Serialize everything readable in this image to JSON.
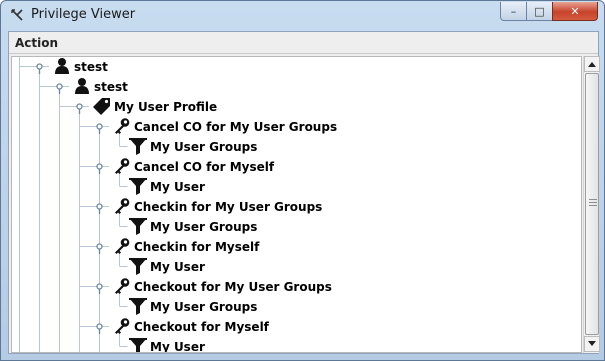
{
  "window": {
    "title": "Privilege Viewer",
    "buttons": {
      "minimize": "–",
      "maximize": "□",
      "close": "✕"
    }
  },
  "menu": {
    "action": "Action"
  },
  "tree": {
    "nodes": [
      {
        "label": "stest",
        "icon": "user-icon",
        "depth": 0
      },
      {
        "label": "stest",
        "icon": "user-icon",
        "depth": 1
      },
      {
        "label": "My User Profile",
        "icon": "tag-icon",
        "depth": 2
      },
      {
        "label": "Cancel CO for My User Groups",
        "icon": "key-icon",
        "depth": 3
      },
      {
        "label": "My User Groups",
        "icon": "filter-icon",
        "depth": 4
      },
      {
        "label": "Cancel CO for Myself",
        "icon": "key-icon",
        "depth": 3
      },
      {
        "label": "My User",
        "icon": "filter-icon",
        "depth": 4
      },
      {
        "label": "Checkin for My User Groups",
        "icon": "key-icon",
        "depth": 3
      },
      {
        "label": "My User Groups",
        "icon": "filter-icon",
        "depth": 4
      },
      {
        "label": "Checkin for Myself",
        "icon": "key-icon",
        "depth": 3
      },
      {
        "label": "My User",
        "icon": "filter-icon",
        "depth": 4
      },
      {
        "label": "Checkout for My User Groups",
        "icon": "key-icon",
        "depth": 3
      },
      {
        "label": "My User Groups",
        "icon": "filter-icon",
        "depth": 4
      },
      {
        "label": "Checkout for Myself",
        "icon": "key-icon",
        "depth": 3
      },
      {
        "label": "My User",
        "icon": "filter-icon",
        "depth": 4
      }
    ]
  },
  "colors": {
    "tree_line": "#b7c7d8",
    "handle": "#6b88a8"
  }
}
